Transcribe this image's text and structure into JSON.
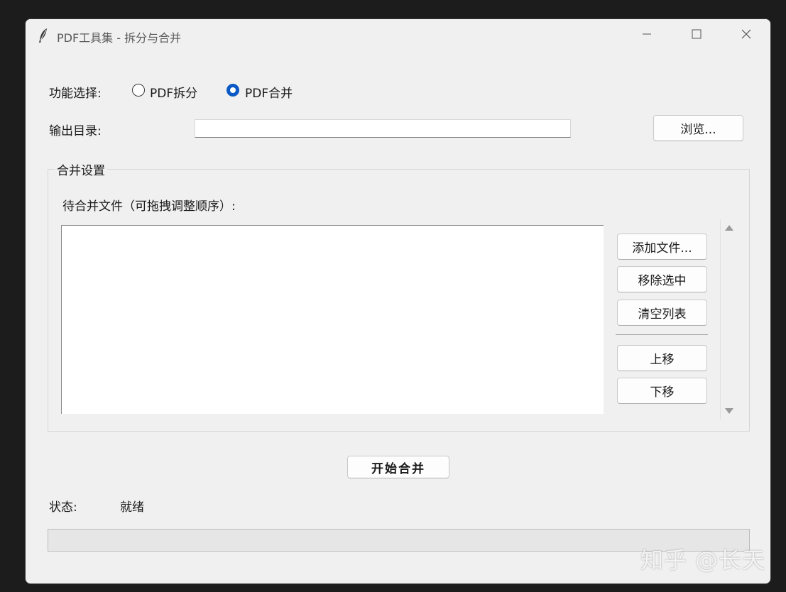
{
  "window": {
    "title": "PDF工具集 - 拆分与合并",
    "icon": "feather-icon",
    "controls": [
      "minimize-icon",
      "maximize-icon",
      "close-icon"
    ]
  },
  "mode": {
    "label": "功能选择:",
    "options": [
      {
        "label": "PDF拆分",
        "selected": false
      },
      {
        "label": "PDF合并",
        "selected": true
      }
    ]
  },
  "output": {
    "label": "输出目录:",
    "value": "",
    "browse_label": "浏览..."
  },
  "merge": {
    "group_title": "合并设置",
    "list_label": "待合并文件（可拖拽调整顺序）:",
    "files": [],
    "buttons": {
      "add": "添加文件...",
      "remove": "移除选中",
      "clear": "清空列表",
      "up": "上移",
      "down": "下移"
    }
  },
  "start_label": "开始合并",
  "status": {
    "label": "状态:",
    "value": "就绪"
  },
  "progress": {
    "value": 0
  },
  "watermark": "知乎 @长天",
  "colors": {
    "accent": "#0a59c4",
    "window_bg": "#f0f0f0"
  }
}
